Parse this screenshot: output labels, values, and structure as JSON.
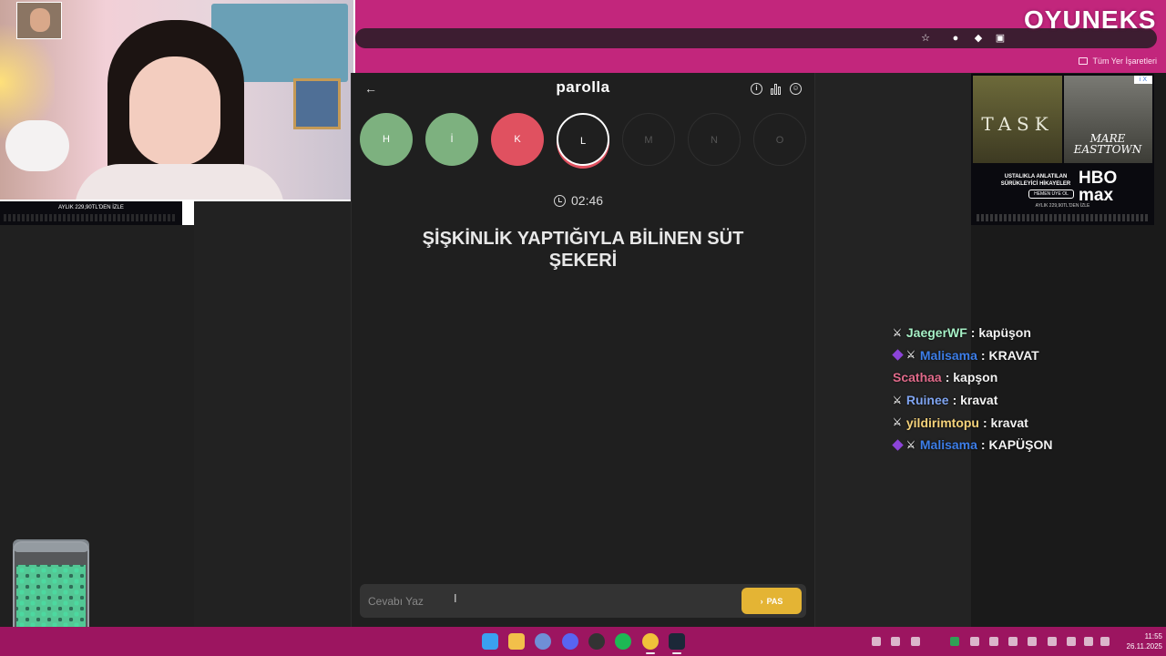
{
  "browser": {
    "bookmarks_label": "Tüm Yer İşaretleri"
  },
  "overlay": {
    "logo": "OYUNEKS",
    "small_ad_line": "AYLIK 229,90TL'DEN İZLE"
  },
  "ad": {
    "poster1_title": "TASK",
    "poster2_title": "MARE EASTTOWN",
    "copy": "USTALIKLA ANLATILAN SÜRÜKLEYİCİ HİKAYELER",
    "cta": "HEMEN ÜYE OL",
    "logo": "HBO max",
    "price": "AYLIK 229,90TL'DEN İZLE",
    "close_label": "i X"
  },
  "game": {
    "title": "parolla",
    "letters": [
      {
        "label": "H",
        "state": "correct"
      },
      {
        "label": "İ",
        "state": "correct"
      },
      {
        "label": "K",
        "state": "wrong"
      },
      {
        "label": "L",
        "state": "current"
      },
      {
        "label": "M",
        "state": "pending"
      },
      {
        "label": "N",
        "state": "pending"
      },
      {
        "label": "O",
        "state": "pending"
      }
    ],
    "timer": "02:46",
    "question": "ŞİŞKİNLİK YAPTIĞIYLA BİLİNEN SÜT ŞEKERİ",
    "answer_placeholder": "Cevabı Yaz",
    "pass_label": "PAS"
  },
  "chat": [
    {
      "user": "JaegerWF",
      "color": "#a6f0c6",
      "text": ": kapüşon",
      "badges": [
        "sword"
      ]
    },
    {
      "user": "Malisama",
      "color": "#3d7ee8",
      "text": ": KRAVAT",
      "badges": [
        "sub",
        "sword"
      ]
    },
    {
      "user": "Scathaa",
      "color": "#e06a8a",
      "text": ": kapşon",
      "badges": []
    },
    {
      "user": "Ruinee",
      "color": "#7fa4f0",
      "text": ": kravat",
      "badges": [
        "sword"
      ]
    },
    {
      "user": "yildirimtopu",
      "color": "#f5d27a",
      "text": ": kravat",
      "badges": [
        "sword"
      ]
    },
    {
      "user": "Malisama",
      "color": "#3d7ee8",
      "text": ": KAPÜŞON",
      "badges": [
        "sub",
        "sword"
      ]
    }
  ],
  "taskbar": {
    "time": "11:55",
    "date": "26.11.2025"
  },
  "colors": {
    "accent_pink": "#c2267c",
    "correct_green": "#7db17f",
    "wrong_red": "#e05160",
    "pass_yellow": "#e4b434"
  }
}
